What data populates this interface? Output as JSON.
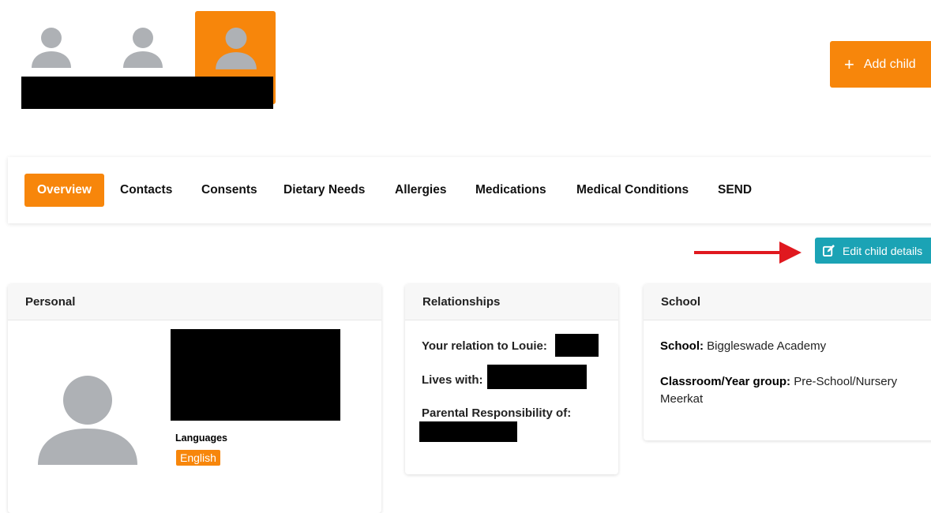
{
  "header": {
    "add_child_label": "Add child",
    "child_tabs": [
      {
        "icon": "user-icon",
        "active": false
      },
      {
        "icon": "user-icon",
        "active": false
      },
      {
        "icon": "user-icon",
        "active": true
      }
    ]
  },
  "tabs": [
    "Overview",
    "Contacts",
    "Consents",
    "Dietary Needs",
    "Allergies",
    "Medications",
    "Medical Conditions",
    "SEND"
  ],
  "active_tab": "Overview",
  "edit_button_label": "Edit child details",
  "personal": {
    "title": "Personal",
    "languages_label": "Languages",
    "language": "English"
  },
  "relationships": {
    "title": "Relationships",
    "relation_label": "Your relation to Louie:",
    "lives_with_label": "Lives with:",
    "parental_label": "Parental Responsibility of:"
  },
  "school": {
    "title": "School",
    "school_label": "School:",
    "school_value": "Biggleswade Academy",
    "class_label": "Classroom/Year group:",
    "class_value": "Pre-School/Nursery Meerkat"
  },
  "colors": {
    "accent": "#f7860b",
    "edit": "#1ba3b5",
    "arrow": "#e0191f",
    "avatar": "#aeb1b5"
  }
}
